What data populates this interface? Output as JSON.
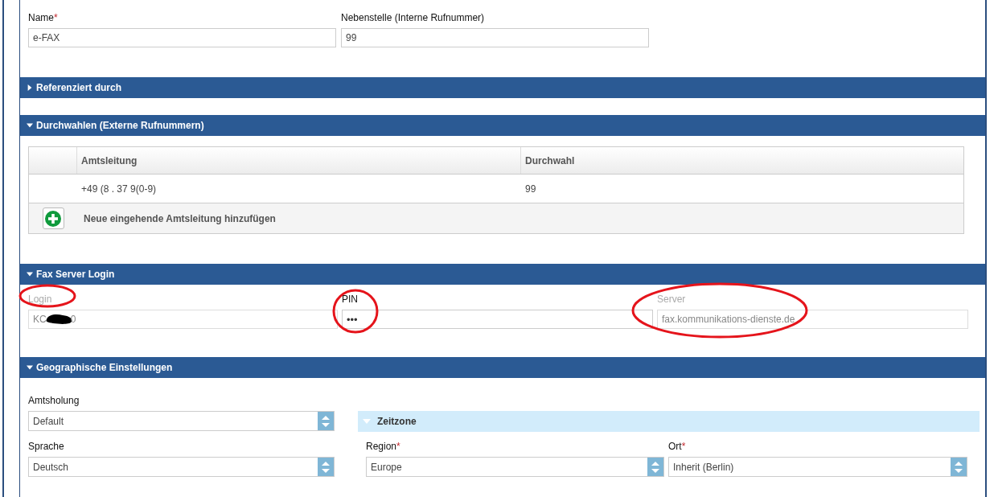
{
  "general": {
    "fields": [
      {
        "label": "Name",
        "required_mark": "*",
        "value": "e-FAX"
      },
      {
        "label": "Nebenstelle (Interne Rufnummer)",
        "value": "99"
      }
    ]
  },
  "sections": [
    {
      "kind": "referenced",
      "title": "Referenziert durch",
      "expanded": false
    },
    {
      "kind": "extensions",
      "title": "Durchwahlen (Externe Rufnummern)",
      "expanded": true,
      "table": {
        "columns": [
          "Amtsleitung",
          "Durchwahl"
        ],
        "rows": [
          [
            "+49 (8      . 37  9(0-9)",
            "99"
          ]
        ],
        "add_label": "Neue eingehende Amtsleitung hinzufügen"
      }
    },
    {
      "kind": "fax",
      "title": "Fax Server Login",
      "expanded": true,
      "fields": [
        {
          "label": "Login",
          "disabled": true,
          "value_start": "KC",
          "value_end": "0",
          "redacted": true
        },
        {
          "label": "PIN",
          "disabled": false,
          "value": "•••"
        },
        {
          "label": "Server",
          "disabled": true,
          "value": "fax.kommunikations-dienste.de"
        }
      ]
    },
    {
      "kind": "geo",
      "title": "Geographische Einstellungen",
      "expanded": true,
      "amtsholung": {
        "label": "Amtsholung",
        "value": "Default"
      },
      "zeitzone": {
        "title": "Zeitzone",
        "expanded": true
      },
      "selects": [
        {
          "label": "Sprache",
          "value": "Deutsch"
        },
        {
          "label": "Region",
          "required_mark": "*",
          "value": "Europe"
        },
        {
          "label": "Ort",
          "required_mark": "*",
          "value": "Inherit (Berlin)"
        }
      ]
    }
  ]
}
